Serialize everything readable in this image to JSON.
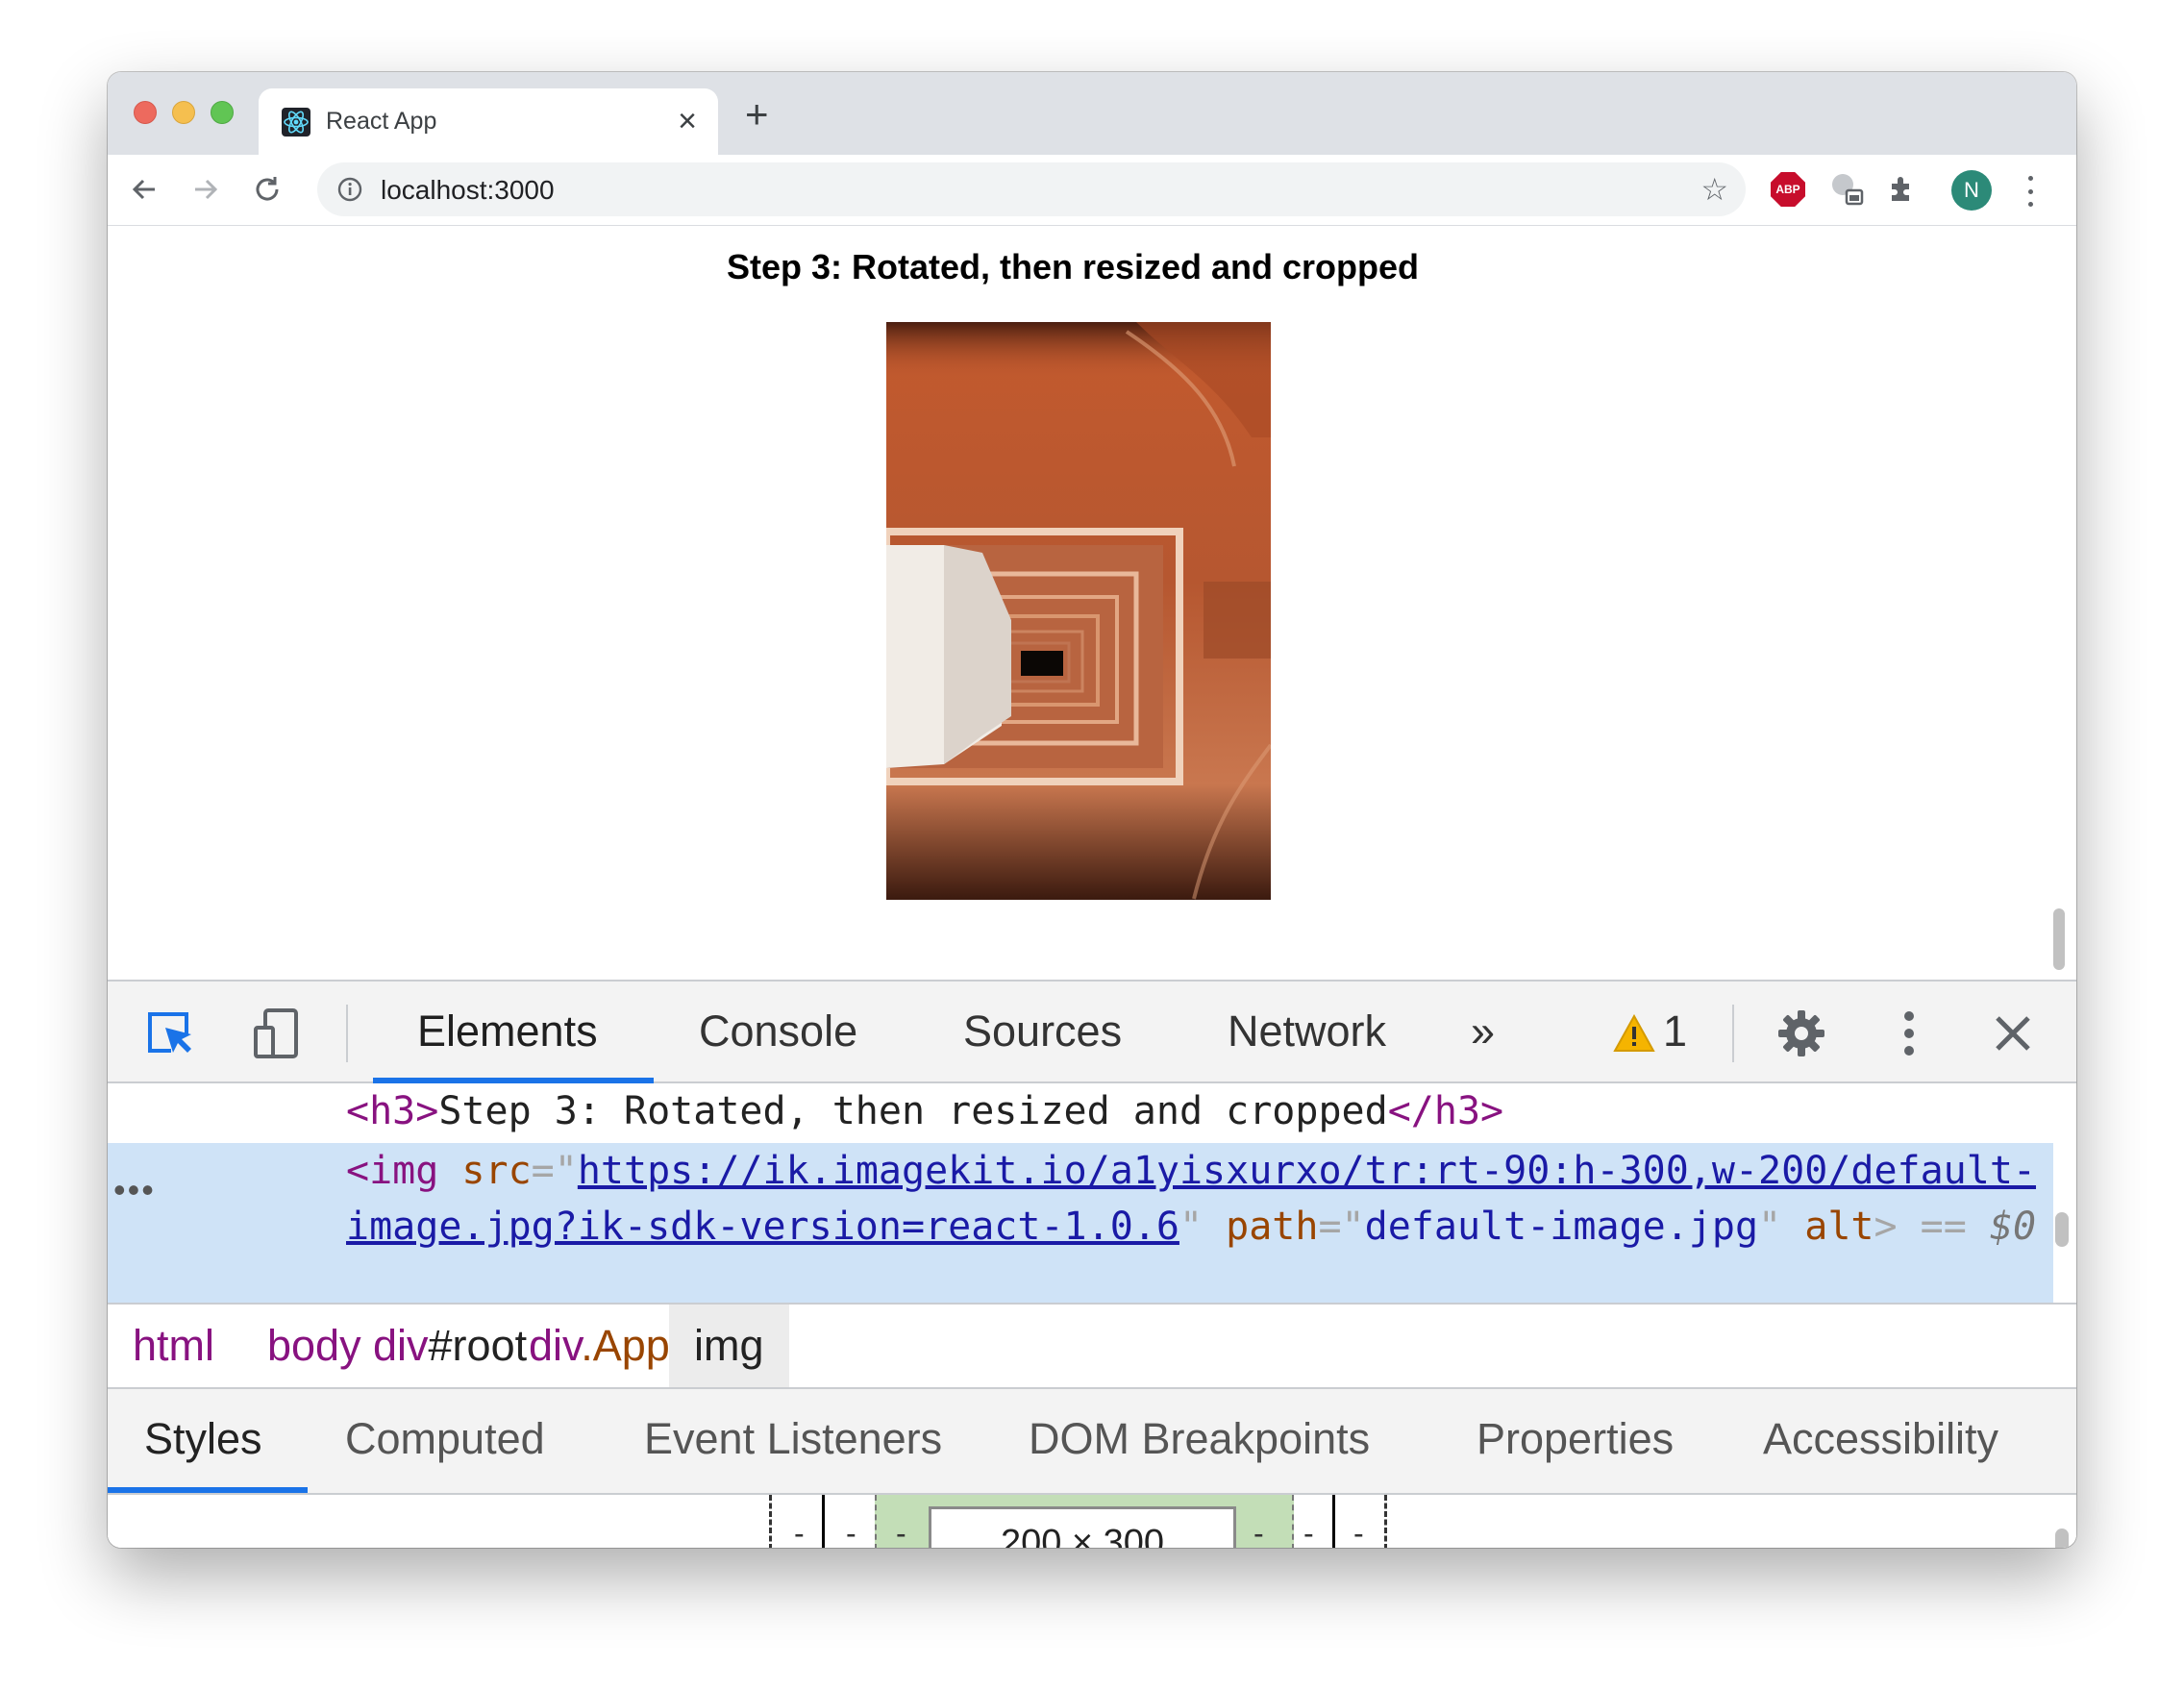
{
  "browser": {
    "tab_title": "React App",
    "url": "localhost:3000",
    "avatar_initial": "N",
    "abp_label": "ABP"
  },
  "page": {
    "heading": "Step 3: Rotated, then resized and cropped"
  },
  "devtools": {
    "tabs": [
      "Elements",
      "Console",
      "Sources",
      "Network"
    ],
    "active_tab": "Elements",
    "more_tabs_glyph": "»",
    "warning_count": "1",
    "dom": {
      "line1_open_tag": "<h3>",
      "line1_text": "Step 3: Rotated, then resized and cropped",
      "line1_close_tag": "</h3>",
      "selected_ellipsis": "•••",
      "img_open": "<img",
      "src_attr": "src",
      "src_value": "https://ik.imagekit.io/a1yisxurxo/tr:rt-90:h-300,w-200/default-image.jpg?ik-sdk-version=react-1.0.6",
      "path_attr": "path",
      "path_value": "default-image.jpg",
      "alt_attr": "alt",
      "close": ">",
      "eq": "==",
      "dollar": "$0"
    },
    "breadcrumbs": [
      "html",
      "body",
      "div#root",
      "div.App",
      "img"
    ],
    "subtabs": [
      "Styles",
      "Computed",
      "Event Listeners",
      "DOM Breakpoints",
      "Properties",
      "Accessibility"
    ],
    "active_subtab": "Styles",
    "box_model": {
      "content_size": "200 × 300",
      "minus": "-"
    }
  },
  "colors": {
    "accent": "#1a73e8",
    "selected_row": "#cfe3f7",
    "padding_box": "#c3deb7",
    "tag": "#881280",
    "attr": "#994500",
    "attr_value": "#1a1aa6"
  }
}
